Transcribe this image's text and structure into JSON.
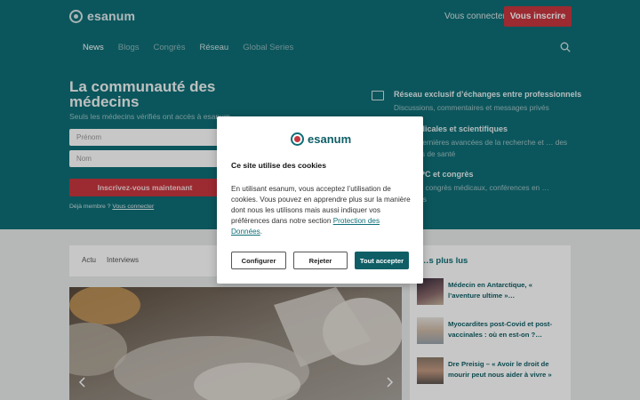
{
  "app": {
    "logo_text": "esanum"
  },
  "header": {
    "login_label": "Vous connecter",
    "signup_label": "Vous inscrire"
  },
  "nav": {
    "items": [
      "News",
      "Blogs",
      "Congrès",
      "Réseau",
      "Global Series"
    ]
  },
  "hero": {
    "title": "La communauté des médecins",
    "subtitle": "Seuls les médecins vérifiés ont accès à esanum",
    "firstname_placeholder": "Prénom",
    "lastname_placeholder": "Nom",
    "cta_label": "Inscrivez-vous maintenant",
    "member_text": "Déjà membre ?",
    "member_link": "Vous connecter"
  },
  "features": [
    {
      "title": "Réseau exclusif d’échanges entre professionnels",
      "desc": "Discussions, commentaires et messages privés"
    },
    {
      "title": "…s médicales et scientifiques",
      "desc": "…z les dernières avancées de la recherche et … des politiques de santé"
    },
    {
      "title": "…on DPC et congrès",
      "desc": "…rts des congrès médicaux, conférences en … eportages"
    }
  ],
  "content": {
    "tabs": [
      "Actu",
      "Interviews"
    ],
    "sidebar_title": "…s plus lus",
    "sidebar_items": [
      "Médecin en Antarctique, « l’aventure ultime »…",
      "Myocardites post-Covid et post-vaccinales : où en est-on ?…",
      "Dre Preisig – « Avoir le droit de mourir peut nous aider à vivre »"
    ]
  },
  "cookie_modal": {
    "logo_text": "esanum",
    "title": "Ce site utilise des cookies",
    "body": "En utilisant esanum, vous acceptez l’utilisation de cookies. Vous pouvez en apprendre plus sur la manière dont nous les utilisons mais aussi indiquer vos préférences dans notre section ",
    "link": "Protection des Données",
    "body_end": ".",
    "configure_label": "Configurer",
    "reject_label": "Rejeter",
    "accept_label": "Tout accepter"
  },
  "colors": {
    "brand_teal": "#0f6f77",
    "accent_red": "#c8363f"
  }
}
